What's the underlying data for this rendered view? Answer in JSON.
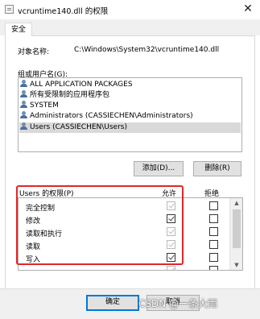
{
  "window": {
    "title": "vcruntime140.dll 的权限",
    "close_glyph": "✕"
  },
  "tabs": [
    {
      "label": "安全"
    }
  ],
  "object": {
    "label": "对象名称:",
    "value": "C:\\Windows\\System32\\vcruntime140.dll"
  },
  "groups": {
    "label": "组或用户名(G):",
    "items": [
      {
        "label": "ALL APPLICATION PACKAGES",
        "icon": "user-group-icon",
        "selected": false
      },
      {
        "label": "所有受限制的应用程序包",
        "icon": "user-group-icon",
        "selected": false
      },
      {
        "label": "SYSTEM",
        "icon": "user-icon",
        "selected": false
      },
      {
        "label": "Administrators (CASSIECHEN\\Administrators)",
        "icon": "user-group-icon",
        "selected": false
      },
      {
        "label": "Users (CASSIECHEN\\Users)",
        "icon": "user-group-icon",
        "selected": true
      }
    ]
  },
  "buttons": {
    "add": "添加(D)...",
    "remove": "删除(R)",
    "ok": "确定",
    "cancel": "取消"
  },
  "permissions": {
    "label": "Users 的权限(P)",
    "allow_header": "允许",
    "deny_header": "拒绝",
    "rows": [
      {
        "name": "完全控制",
        "allow": true,
        "allow_greyed": true,
        "deny": false
      },
      {
        "name": "修改",
        "allow": true,
        "allow_greyed": false,
        "deny": false
      },
      {
        "name": "读取和执行",
        "allow": true,
        "allow_greyed": true,
        "deny": false
      },
      {
        "name": "读取",
        "allow": true,
        "allow_greyed": true,
        "deny": false
      },
      {
        "name": "写入",
        "allow": true,
        "allow_greyed": false,
        "deny": false
      },
      {
        "name": "",
        "allow": true,
        "allow_greyed": true,
        "deny": false
      }
    ]
  },
  "highlight_color": "#e0262b",
  "watermark": "CSDN @一条大雨"
}
